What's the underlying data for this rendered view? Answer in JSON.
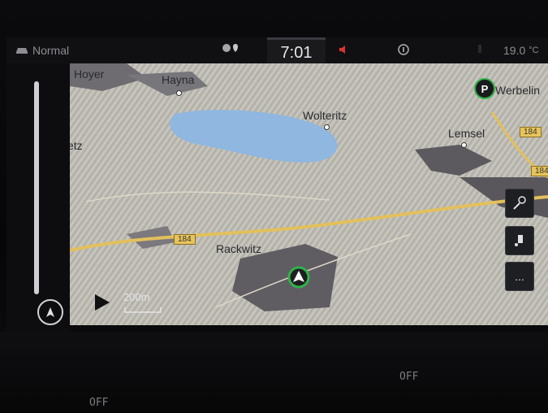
{
  "status": {
    "drive_mode_icon": "car-icon",
    "drive_mode": "Normal",
    "time": "7:01",
    "mute_icon": "speaker-muted-icon",
    "info_icon": "info-circle-icon",
    "temperature": "19.0",
    "temperature_unit": "°C",
    "location_icon": "location-pin-icon"
  },
  "map": {
    "places": [
      {
        "name": "Hoyer"
      },
      {
        "name": "Hayna"
      },
      {
        "name": "Wolteritz"
      },
      {
        "name": "Lemsel"
      },
      {
        "name": "etz"
      },
      {
        "name": "Rackwitz"
      },
      {
        "name": "Werbelin"
      }
    ],
    "roads": [
      "184",
      "184",
      "184"
    ],
    "scale": "200m",
    "parking_label": "P",
    "buttons": {
      "search_icon": "search-location-icon",
      "assistant_icon": "route-assist-icon",
      "more_label": "..."
    }
  },
  "bottom": {
    "left_off": "OFF",
    "right_off": "OFF"
  },
  "colors": {
    "map_base": "#b4b2a8",
    "water": "#8fb7e0",
    "road": "#e7c45a",
    "position_marker": "#2fb34a"
  }
}
